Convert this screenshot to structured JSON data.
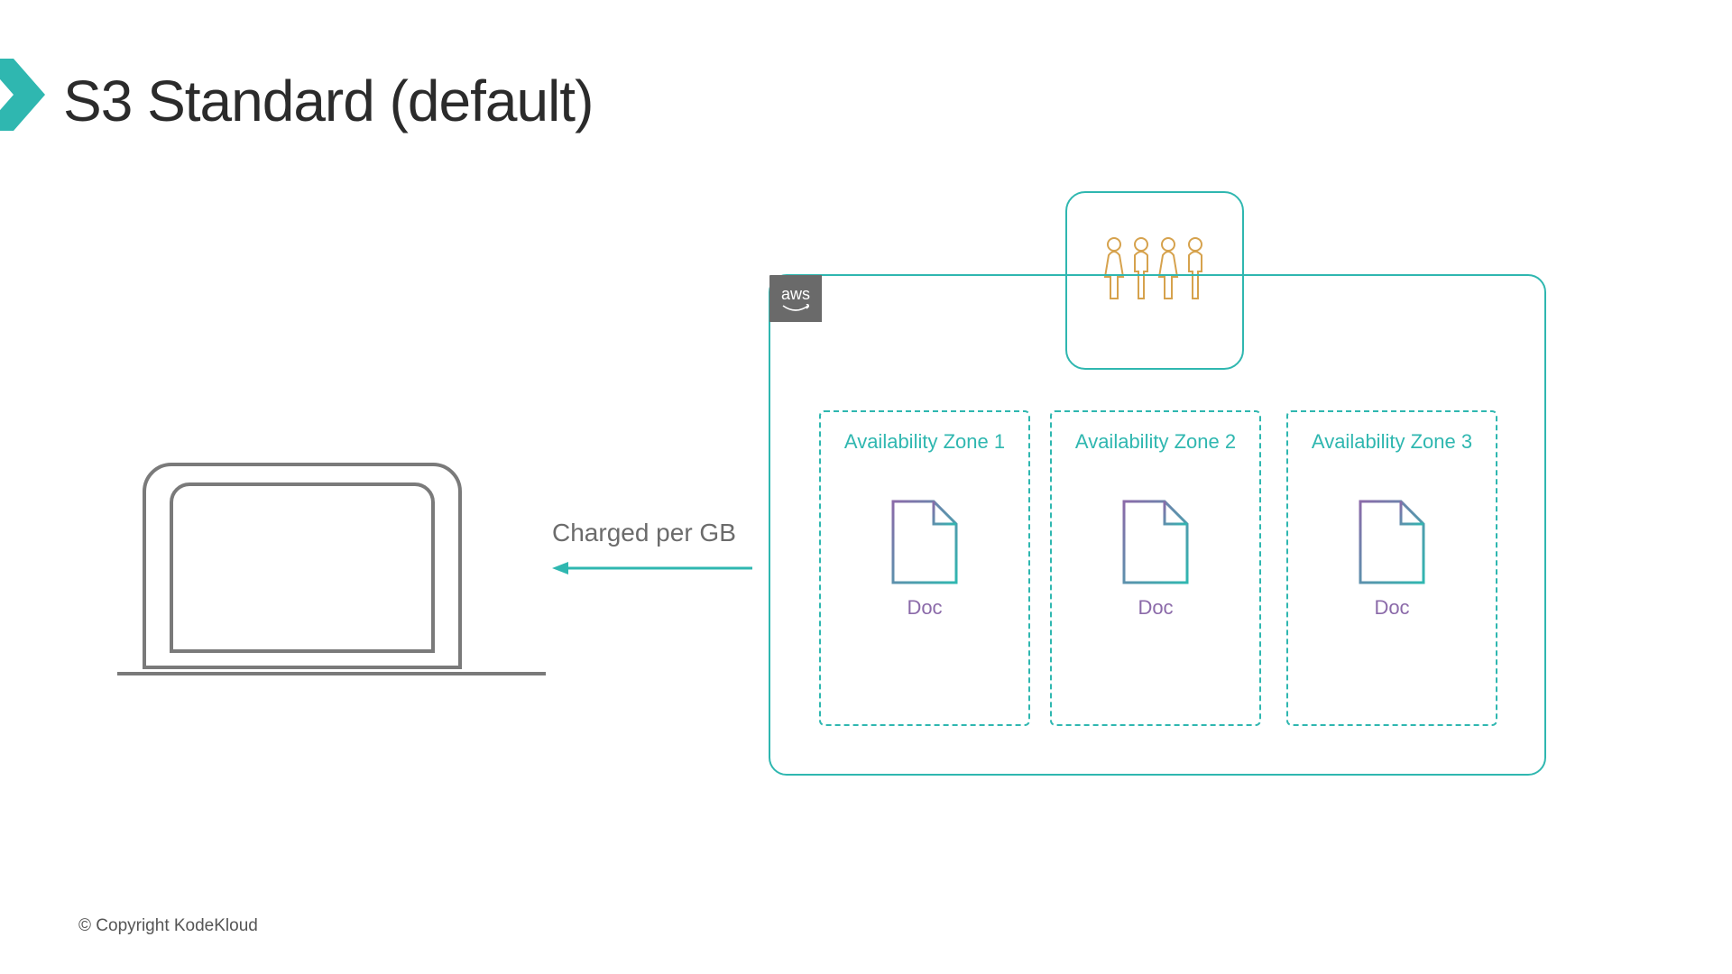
{
  "title": "S3 Standard (default)",
  "arrow_label": "Charged per GB",
  "aws_tag": "aws",
  "users_icon": "users-icon",
  "zones": [
    {
      "label": "Availability Zone 1",
      "doc_label": "Doc"
    },
    {
      "label": "Availability Zone 2",
      "doc_label": "Doc"
    },
    {
      "label": "Availability Zone 3",
      "doc_label": "Doc"
    }
  ],
  "copyright": "© Copyright KodeKloud",
  "colors": {
    "teal": "#2fb7b0",
    "purple": "#8b6aa9",
    "gold": "#d6a24d"
  }
}
